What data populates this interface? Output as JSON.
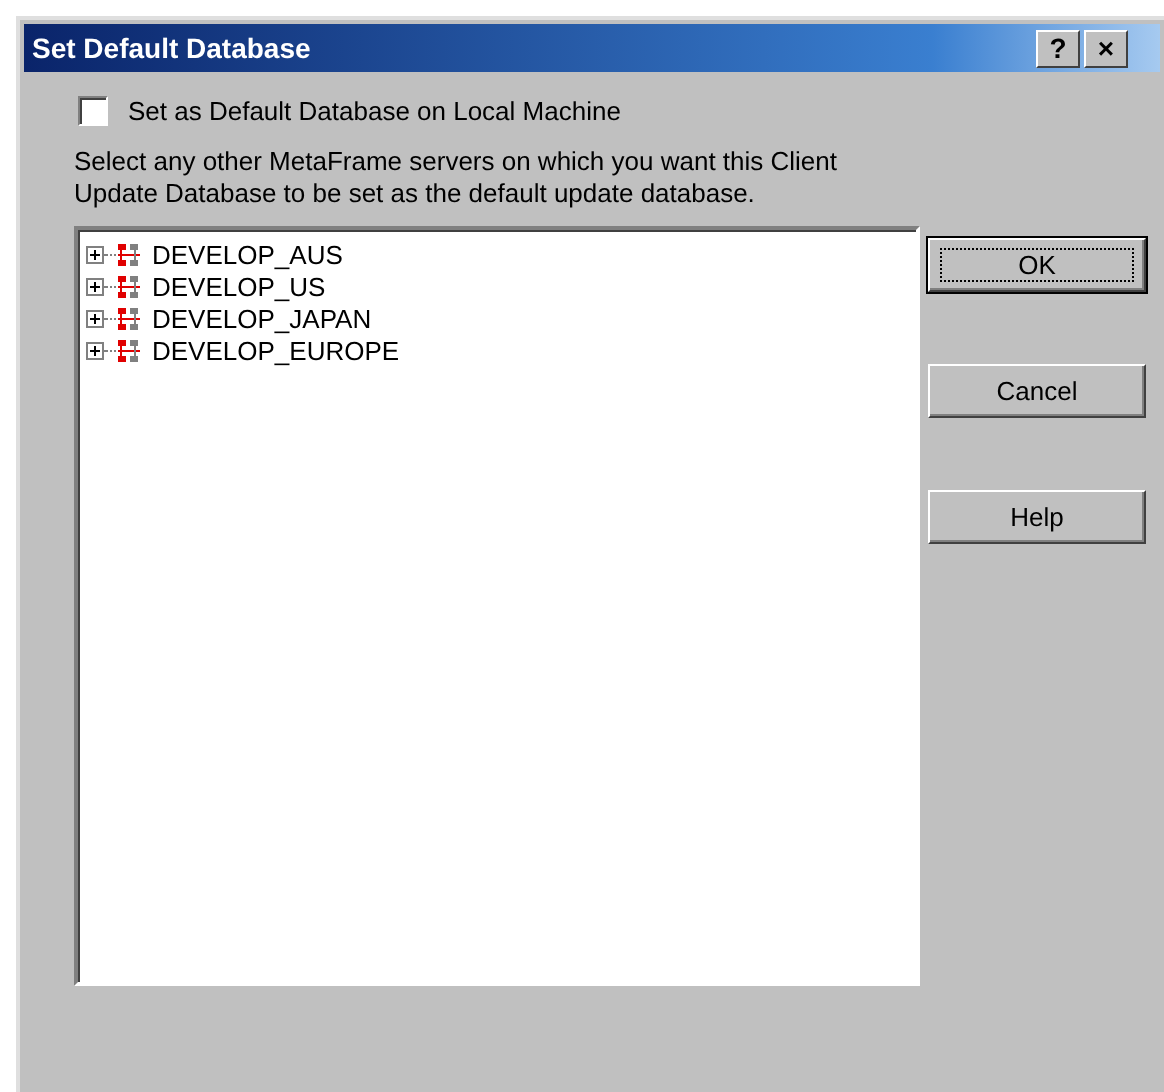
{
  "window": {
    "title": "Set Default Database",
    "title_buttons": [
      "?",
      "×"
    ]
  },
  "local_default": {
    "label": "Set as Default Database on Local Machine",
    "checked": false
  },
  "instructions": "Select any other MetaFrame servers on which you want this Client Update Database to be set as the default update database.",
  "tree": {
    "items": [
      {
        "label": "DEVELOP_AUS",
        "expanded": false
      },
      {
        "label": "DEVELOP_US",
        "expanded": false
      },
      {
        "label": "DEVELOP_JAPAN",
        "expanded": false
      },
      {
        "label": "DEVELOP_EUROPE",
        "expanded": false
      }
    ]
  },
  "buttons": [
    {
      "label": "OK",
      "default": true
    },
    {
      "label": "Cancel",
      "default": false
    },
    {
      "label": "Help",
      "default": false
    }
  ]
}
